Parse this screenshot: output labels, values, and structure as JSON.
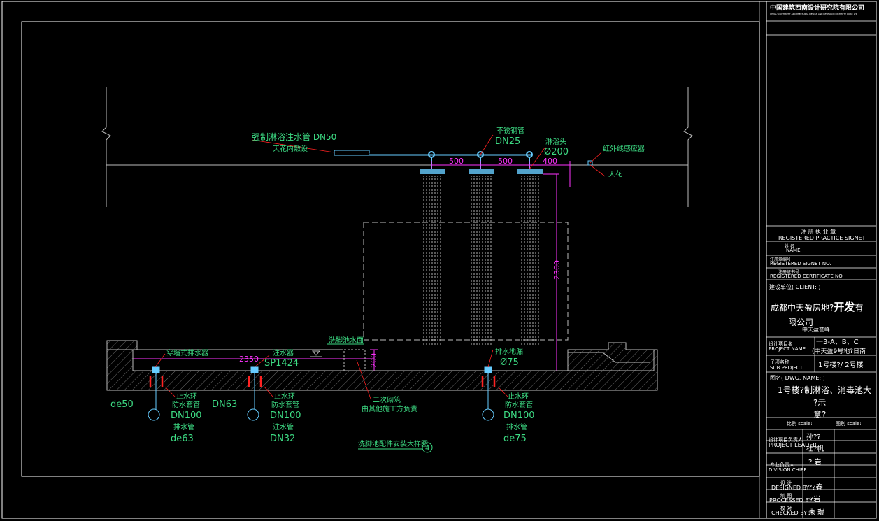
{
  "colors": {
    "background": "#000000",
    "frame": "#ffffff",
    "green_text": "#3ddc84",
    "cyan_pipe": "#66ccff",
    "magenta_dim": "#ff33ff",
    "red_mark": "#ff2222",
    "gray_line": "#bbbbbb"
  },
  "drawing": {
    "pipe_main_label": "强制淋浴注水管 DN50",
    "pipe_main_sub": "天花内敷设",
    "steel_pipe_label": "不锈钢管",
    "steel_pipe_size": "DN25",
    "shower_head_label": "淋浴头",
    "shower_head_size": "Ø200",
    "sensor_label": "红外线感应器",
    "ceiling_label": "天花",
    "dim_500_a": "500",
    "dim_500_b": "500",
    "dim_400": "400",
    "dim_2300": "2300",
    "dim_2350": "2350",
    "dim_200": "200",
    "pool_water_label": "洗脚池水面",
    "drain_left_label": "穿墙式排水器",
    "inlet_label": "注水器",
    "inlet_model": "SP1424",
    "floor_drain_label": "排水地漏",
    "floor_drain_size": "Ø75",
    "secondary_label": "二次砌筑",
    "secondary_sub": "由其他施工方负责",
    "stop_ring_1": "止水环",
    "sleeve_1": "防水套管",
    "sleeve_size_1": "DN100",
    "drain_pipe_1": "排水管",
    "drain_pipe_size_1": "de63",
    "de50": "de50",
    "dn63": "DN63",
    "stop_ring_2": "止水环",
    "sleeve_2": "防水套管",
    "sleeve_size_2": "DN100",
    "inlet_pipe_2": "注水管",
    "inlet_pipe_size_2": "DN32",
    "stop_ring_3": "止水环",
    "sleeve_3": "防水套管",
    "sleeve_size_3": "DN100",
    "drain_pipe_3": "排水管",
    "drain_pipe_size_3": "de75",
    "detail_title": "洗脚池配件安装大样图",
    "detail_no": "4"
  },
  "title_block": {
    "company_cn": "中国建筑西南设计研究院有限公司",
    "company_en": "CHINA SOUTHWEST ARCHITECTURAL DESIGN AND RESEARCH INSTITUTE CORP. LTD",
    "signet_cn": "注 册 执 业 章",
    "signet_en": "REGISTERED PRACTICE SIGNET",
    "name_cn": "姓 名",
    "name_en": "NAME",
    "reg_signet_cn": "注册章编号",
    "reg_signet_en": "REGISTERED SIGNET NO.",
    "reg_cert_cn": "注册证书号",
    "reg_cert_en": "REGISTERED CERTIFICATE NO.",
    "client_label": "建设单位( CLIENT: )",
    "client_line1_a": "成都中天盈房地?",
    "client_line1_b": "开发",
    "client_line1_c": "有",
    "client_line2": "限公司",
    "project_short": "中天盈誉峰",
    "project_label_cn": "设计项目名",
    "project_label_en": "PROJECT NAME",
    "project_value_1": "一3-A、B、C",
    "project_value_2": "(中天盈9号地?日南",
    "sub_project_cn": "子项名称",
    "sub_project_en": "SUB PROJECT",
    "sub_project_value": "1号楼?/ 2号楼",
    "dwg_label": "图名( DWG. NAME: )",
    "dwg_line1": "1号楼?制淋浴、消毒池大",
    "dwg_line2": "?示",
    "dwg_line3": "意?",
    "scale_label": "比例 scale:",
    "dwg_no_label": "图别 scale:",
    "leader_cn": "设计项目负责人",
    "leader_en": "PROJECT LEADER",
    "leader_value_1": "孙??",
    "leader_value_2": "杜?帆",
    "chief_cn": "专业负责人",
    "chief_en": "DIVISION CHIEF",
    "chief_value": "? 岩",
    "designed_cn": "设 计",
    "designed_en": "DESIGNED BY",
    "designed_value": "??春",
    "processed_cn": "制 图",
    "processed_en": "PROCESSED BY",
    "processed_value": "?岩",
    "checked_cn": "校 对",
    "checked_en": "CHECKED BY",
    "checked_value": "朱 瑞"
  }
}
